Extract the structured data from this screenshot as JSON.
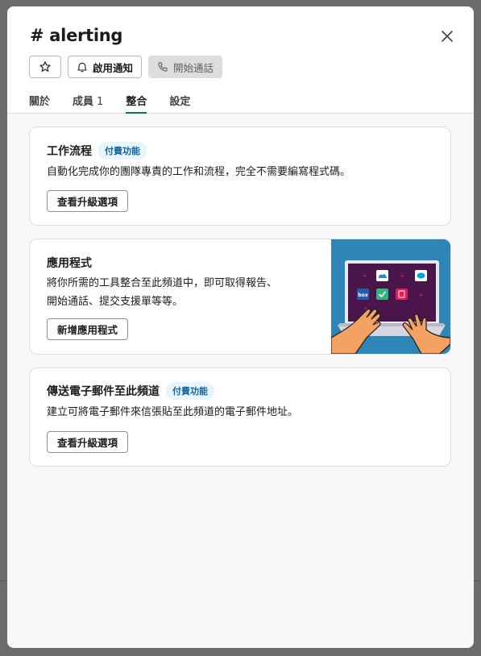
{
  "channel": {
    "title": "# alerting"
  },
  "actions": {
    "notify_label": "啟用通知",
    "call_label": "開始通話"
  },
  "tabs": [
    {
      "label": "關於"
    },
    {
      "label": "成員",
      "count": "1"
    },
    {
      "label": "整合"
    },
    {
      "label": "設定"
    }
  ],
  "cards": {
    "workflow": {
      "title": "工作流程",
      "badge": "付費功能",
      "desc": "自動化完成你的團隊專責的工作和流程，完全不需要編寫程式碼。",
      "button": "查看升級選項"
    },
    "apps": {
      "title": "應用程式",
      "desc_line1": "將你所需的工具整合至此頻道中，即可取得報告、",
      "desc_line2": "開始通話、提交支援單等等。",
      "button": "新增應用程式",
      "illustration_tile_label": "box"
    },
    "email": {
      "title": "傳送電子郵件至此頻道",
      "badge": "付費功能",
      "desc": "建立可將電子郵件來信張貼至此頻道的電子郵件地址。",
      "button": "查看升級選項"
    }
  },
  "colors": {
    "accent_tab": "#007a5a",
    "badge_text": "#1264a3",
    "illustration_bg": "#2d86b5"
  }
}
